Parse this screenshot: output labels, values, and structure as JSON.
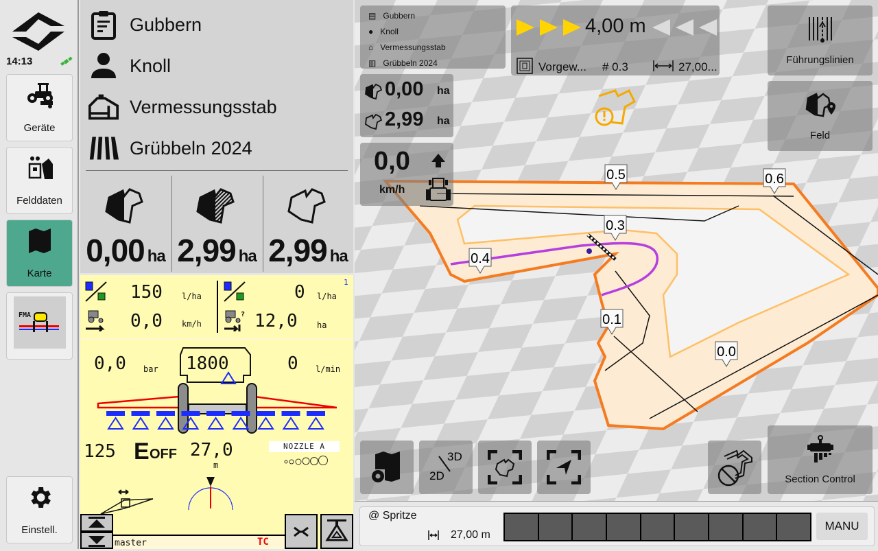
{
  "status": {
    "time": "14:13",
    "gps_icon": "satellite-icon"
  },
  "nav": {
    "items": [
      {
        "label": "Geräte",
        "icon": "tractor-gear-icon"
      },
      {
        "label": "Felddaten",
        "icon": "field-data-icon"
      },
      {
        "label": "Karte",
        "icon": "map-icon",
        "active": true
      },
      {
        "label": "FMA",
        "icon": "sprayer-app-icon"
      },
      {
        "label": "Einstell.",
        "icon": "gear-icon"
      }
    ]
  },
  "job": {
    "customer": "Gubbern",
    "farmer": "Knoll",
    "farm": "Vermessungsstab",
    "field": "Grübbeln 2024"
  },
  "areas": [
    {
      "value": "0,00",
      "unit": "ha",
      "icon": "worked-area-icon"
    },
    {
      "value": "2,99",
      "unit": "ha",
      "icon": "remaining-area-icon"
    },
    {
      "value": "2,99",
      "unit": "ha",
      "icon": "field-area-icon"
    }
  ],
  "iso": {
    "page_num": "1",
    "rate_target": "150",
    "rate_target_unit": "l/ha",
    "rate_actual": "0",
    "rate_actual_unit": "l/ha",
    "speed": "0,0",
    "speed_unit": "km/h",
    "area_left": "12,0",
    "area_left_unit": "ha",
    "pressure": "0,0",
    "pressure_unit": "bar",
    "tank": "1800",
    "flow": "0",
    "flow_unit": "l/min",
    "counter": "125",
    "e_label": "E",
    "e_state": "OFF",
    "width": "27,0",
    "width_unit": "m",
    "nozzle": "NOZZLE A",
    "master_label": "master",
    "tc_label": "TC",
    "sections_count": 9
  },
  "map": {
    "info": {
      "customer": "Gubbern",
      "farmer": "Knoll",
      "farm": "Vermessungsstab",
      "field": "Grübbeln 2024"
    },
    "lightbar": {
      "offset": "4,00 m",
      "left_active": 3,
      "right_active": 0
    },
    "guidance": {
      "pattern": "Vorgew...",
      "line_no": "# 0.3",
      "width": "27,00..."
    },
    "area_worked": {
      "value": "0,00",
      "unit": "ha"
    },
    "area_total": {
      "value": "2,99",
      "unit": "ha"
    },
    "speed": {
      "value": "0,0",
      "unit": "km/h"
    },
    "buttons": {
      "guidance_lines": "Führungslinien",
      "field": "Feld",
      "section_control": "Section Control"
    },
    "markers": [
      "0.5",
      "0.6",
      "0.3",
      "0.4",
      "0.1",
      "0.0"
    ],
    "colors": {
      "boundary": "#f47b20",
      "headland": "#ffbf66",
      "track": "#b53fe0",
      "warning": "#f5a900"
    }
  },
  "bottom": {
    "implement": "@ Spritze",
    "width": "27,00 m",
    "sections": 9,
    "mode": "MANU"
  }
}
